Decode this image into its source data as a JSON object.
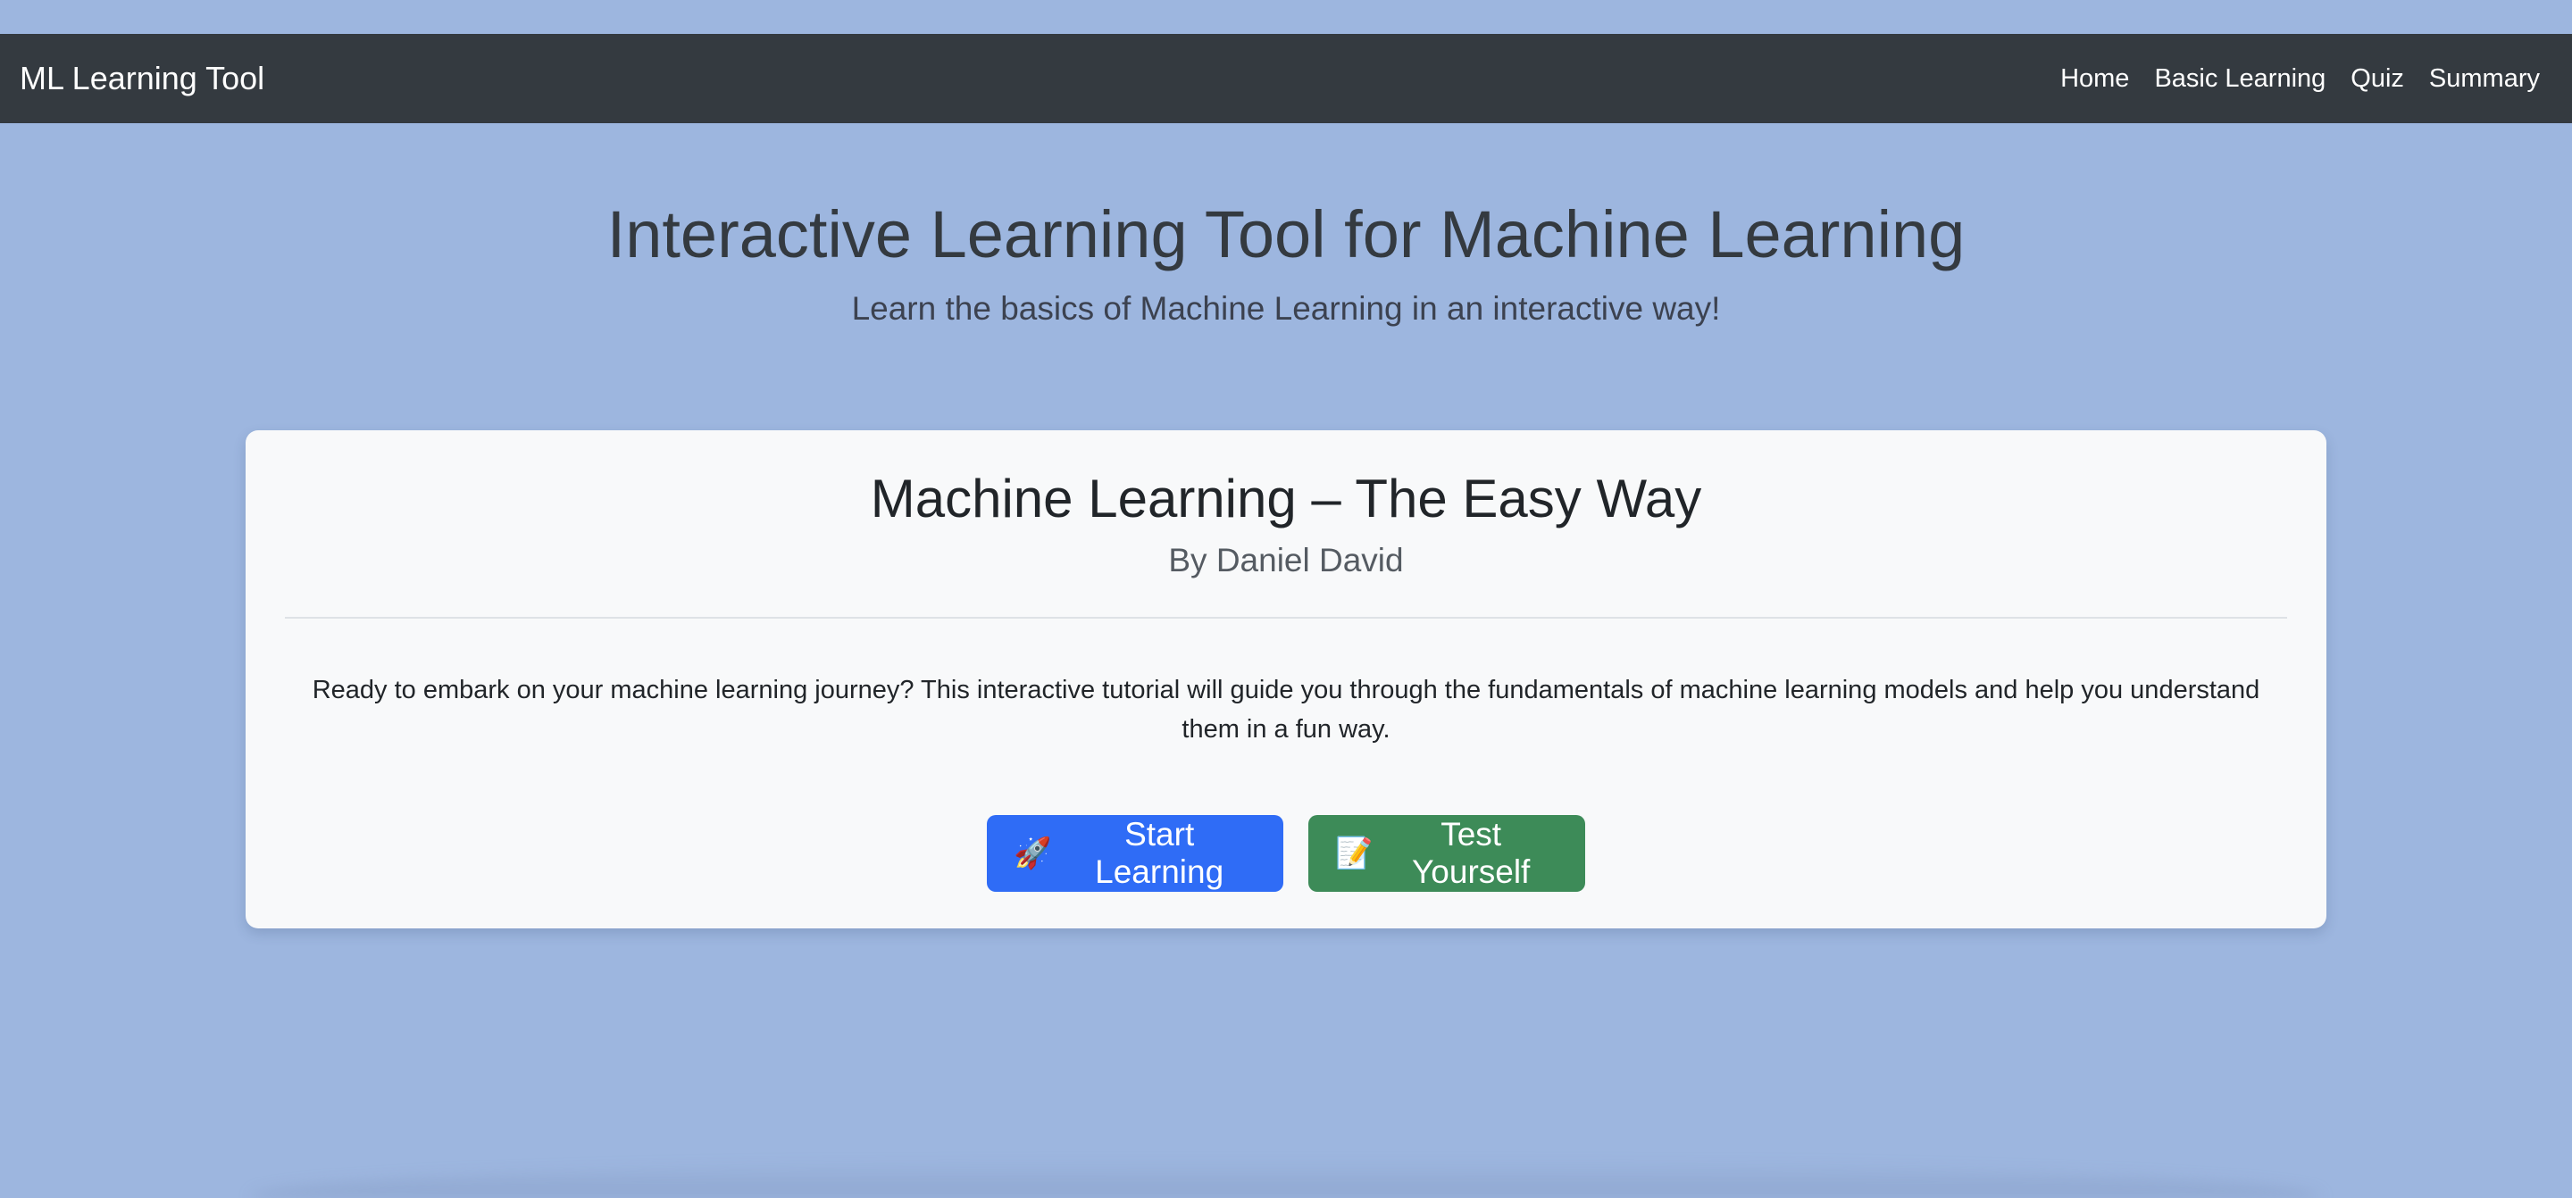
{
  "navbar": {
    "brand": "ML Learning Tool",
    "links": [
      {
        "label": "Home"
      },
      {
        "label": "Basic Learning"
      },
      {
        "label": "Quiz"
      },
      {
        "label": "Summary"
      }
    ]
  },
  "hero": {
    "title": "Interactive Learning Tool for Machine Learning",
    "subtitle": "Learn the basics of Machine Learning in an interactive way!"
  },
  "card": {
    "title": "Machine Learning – The Easy Way",
    "author": "By Daniel David",
    "description": "Ready to embark on your machine learning journey? This interactive tutorial will guide you through the fundamentals of machine learning models and help you understand them in a fun way.",
    "buttons": {
      "start": {
        "icon": "🚀",
        "icon_name": "rocket-icon",
        "label": "Start Learning"
      },
      "test": {
        "icon": "📝",
        "icon_name": "memo-icon",
        "label": "Test Yourself"
      }
    }
  },
  "colors": {
    "background": "#9db6df",
    "navbar": "#343a40",
    "card": "#f8f9fa",
    "primary_button": "#2f6cf6",
    "success_button": "#3d8b58"
  }
}
